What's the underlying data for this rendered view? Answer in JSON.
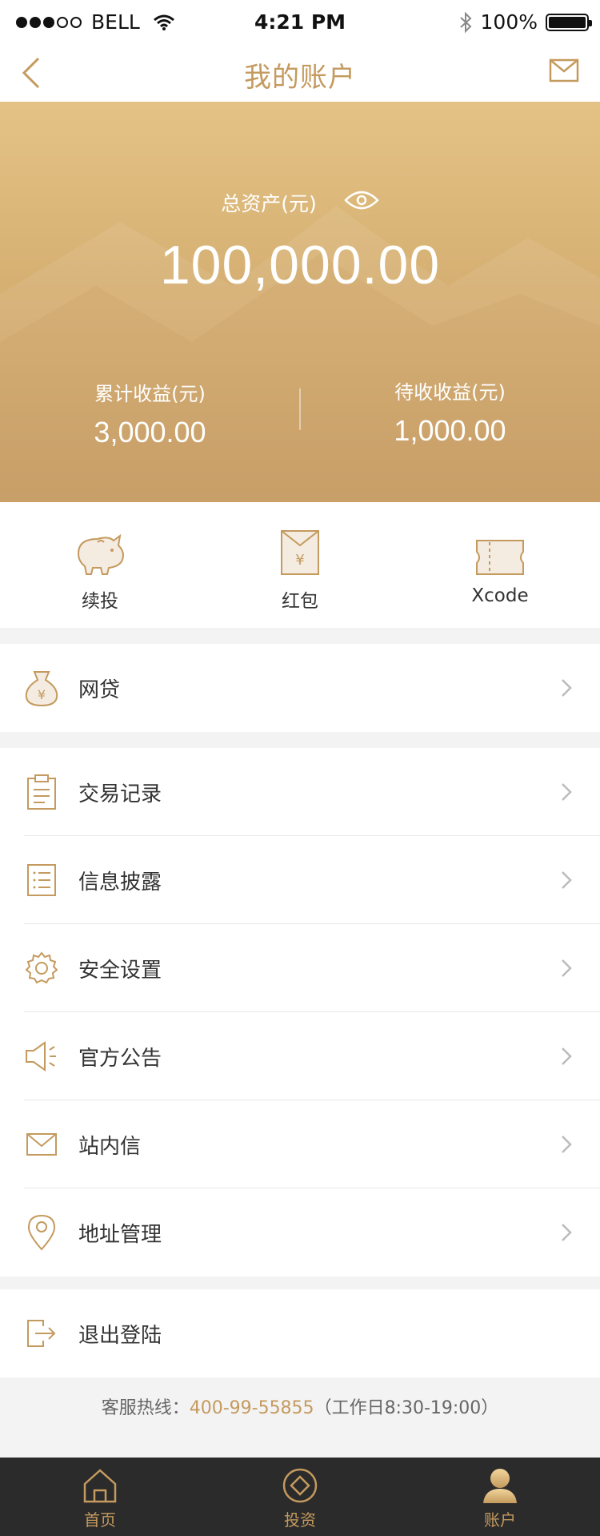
{
  "statusbar": {
    "carrier": "BELL",
    "time": "4:21 PM",
    "battery": "100%"
  },
  "navbar": {
    "title": "我的账户"
  },
  "summary": {
    "total_label": "总资产(元)",
    "total_value": "100,000.00",
    "cumulative_label": "累计收益(元)",
    "cumulative_value": "3,000.00",
    "pending_label": "待收收益(元)",
    "pending_value": "1,000.00"
  },
  "quick": [
    {
      "label": "续投",
      "icon": "piggy-bank-icon"
    },
    {
      "label": "红包",
      "icon": "red-envelope-icon"
    },
    {
      "label": "Xcode",
      "icon": "ticket-icon"
    }
  ],
  "menu_loan": {
    "label": "网贷",
    "icon": "money-bag-icon"
  },
  "menu": [
    {
      "label": "交易记录",
      "icon": "clipboard-icon"
    },
    {
      "label": "信息披露",
      "icon": "document-list-icon"
    },
    {
      "label": "安全设置",
      "icon": "gear-icon"
    },
    {
      "label": "官方公告",
      "icon": "speaker-icon"
    },
    {
      "label": "站内信",
      "icon": "mail-icon"
    },
    {
      "label": "地址管理",
      "icon": "location-pin-icon"
    }
  ],
  "logout": {
    "label": "退出登陆",
    "icon": "logout-icon"
  },
  "hotline": {
    "prefix": "客服热线：",
    "phone": "400-99-55855",
    "hours": "（工作日8:30-19:00）"
  },
  "tabs": [
    {
      "label": "首页",
      "icon": "home-icon"
    },
    {
      "label": "投资",
      "icon": "invest-icon"
    },
    {
      "label": "账户",
      "icon": "account-icon"
    }
  ],
  "colors": {
    "accent": "#c49a5e",
    "tabbar": "#2b2b2b",
    "hero_top": "#e4c285",
    "hero_bottom": "#c89c61"
  }
}
